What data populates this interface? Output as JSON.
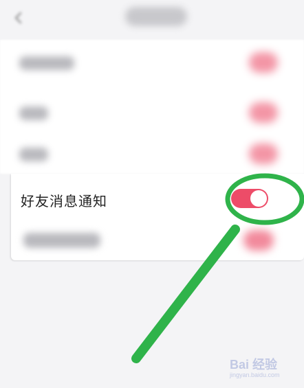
{
  "header": {
    "back_icon": "back-arrow-icon"
  },
  "settings": {
    "focus_item": {
      "label": "好友消息通知",
      "toggle_state": "on"
    }
  },
  "colors": {
    "toggle_on": "#ed4c68",
    "annotation": "#2fb34a"
  },
  "watermark": {
    "main": "Bai 经验",
    "sub": "jingyan.baidu.com"
  }
}
